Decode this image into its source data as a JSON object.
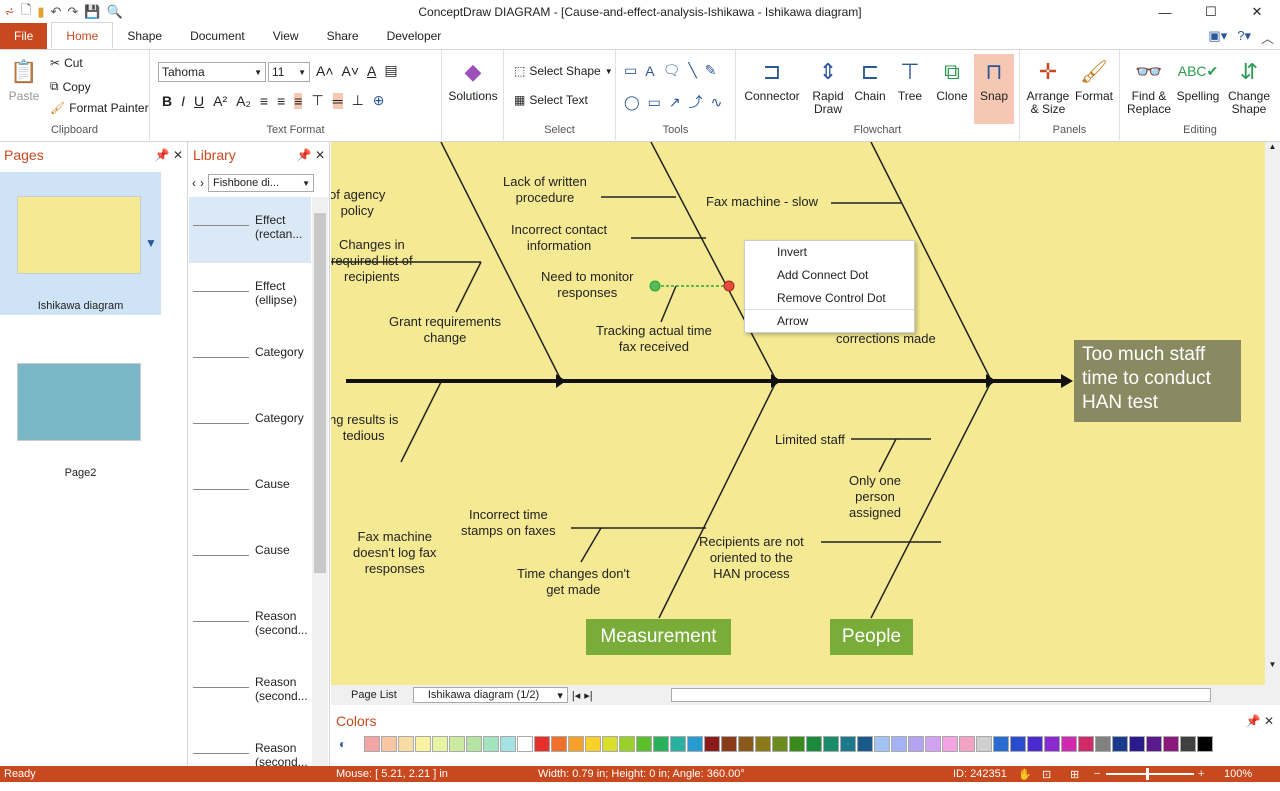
{
  "window": {
    "title": "ConceptDraw DIAGRAM - [Cause-and-effect-analysis-Ishikawa - Ishikawa diagram]"
  },
  "tabs": [
    "File",
    "Home",
    "Shape",
    "Document",
    "View",
    "Share",
    "Developer"
  ],
  "ribbon": {
    "clipboard": {
      "paste": "Paste",
      "cut": "Cut",
      "copy": "Copy",
      "format_painter": "Format Painter",
      "label": "Clipboard"
    },
    "text_format": {
      "font": "Tahoma",
      "size": "11",
      "label": "Text Format"
    },
    "solutions": {
      "label": "Solutions"
    },
    "select": {
      "select_shape": "Select Shape",
      "select_text": "Select Text",
      "label": "Select"
    },
    "tools": {
      "label": "Tools"
    },
    "flowchart": {
      "connector": "Connector",
      "rapid_draw": "Rapid Draw",
      "chain": "Chain",
      "tree": "Tree",
      "clone": "Clone",
      "snap": "Snap",
      "label": "Flowchart"
    },
    "panels": {
      "arrange": "Arrange & Size",
      "format": "Format",
      "label": "Panels"
    },
    "editing": {
      "find": "Find & Replace",
      "spelling": "Spelling",
      "change_shape": "Change Shape",
      "label": "Editing"
    }
  },
  "pages_panel": {
    "title": "Pages",
    "pages": [
      {
        "name": "Ishikawa diagram"
      },
      {
        "name": "Page2"
      }
    ]
  },
  "library_panel": {
    "title": "Library",
    "dropdown": "Fishbone di...",
    "items": [
      "Effect (rectan...",
      "Effect (ellipse)",
      "Category",
      "Category",
      "Cause",
      "Cause",
      "Reason (second...",
      "Reason (second...",
      "Reason (second..."
    ]
  },
  "diagram": {
    "effect": "Too much staff time to conduct HAN test",
    "categories": [
      "Measurement",
      "People"
    ],
    "labels": [
      {
        "text": "of agency\npolicy"
      },
      {
        "text": "Changes in\nrequired list of\nrecipients"
      },
      {
        "text": "Grant requirements\nchange"
      },
      {
        "text": "Lack of written\nprocedure"
      },
      {
        "text": "Incorrect contact\ninformation"
      },
      {
        "text": "Need to monitor\nresponses"
      },
      {
        "text": "Tracking actual time\nfax received"
      },
      {
        "text": "Fax machine - slow"
      },
      {
        "text": "d as\ncorrections made"
      },
      {
        "text": "ng results is\ntedious"
      },
      {
        "text": "Fax machine\ndoesn't log fax\nresponses"
      },
      {
        "text": "Incorrect time\nstamps on faxes"
      },
      {
        "text": "Time changes don't\nget made"
      },
      {
        "text": "Limited staff"
      },
      {
        "text": "Only one\nperson\nassigned"
      },
      {
        "text": "Recipients are not\noriented to the\nHAN process"
      }
    ]
  },
  "context_menu": [
    "Invert",
    "Add Connect Dot",
    "Remove Control Dot",
    "Arrow"
  ],
  "page_list": {
    "label": "Page List",
    "current": "Ishikawa diagram (1/2)"
  },
  "colors_panel": {
    "title": "Colors",
    "swatches": [
      "#f4a6a6",
      "#f7c6a3",
      "#f9dca3",
      "#f9f3a3",
      "#e7f3a3",
      "#cdeaa3",
      "#b5e3a3",
      "#a3e3c0",
      "#a3e3e3",
      "#ffffff",
      "#e8302a",
      "#f0702a",
      "#f7a12a",
      "#f7d02a",
      "#d8e02a",
      "#9bd02a",
      "#5bc02a",
      "#2ab05b",
      "#2ab0a0",
      "#2a9bd0",
      "#8b1a1a",
      "#8b3a1a",
      "#8b5a1a",
      "#8b7a1a",
      "#6b8b1a",
      "#3a8b1a",
      "#1a8b3a",
      "#1a8b6b",
      "#1a7a8b",
      "#1a5a8b",
      "#a3c3f3",
      "#a3b3f3",
      "#b3a3f3",
      "#d3a3f3",
      "#f3a3e3",
      "#f3a3c3",
      "#d0d0d0",
      "#2a6bd0",
      "#2a4bd0",
      "#4b2ad0",
      "#8b2ad0",
      "#d02ab0",
      "#d02a6b",
      "#808080",
      "#1a3a8b",
      "#2a1a8b",
      "#5a1a8b",
      "#8b1a7a",
      "#404040",
      "#000000"
    ]
  },
  "status": {
    "ready": "Ready",
    "mouse": "Mouse: [ 5.21, 2.21 ] in",
    "size": "Width: 0.79 in;  Height: 0 in;  Angle: 360.00°",
    "id": "ID: 242351",
    "zoom": "100%"
  }
}
